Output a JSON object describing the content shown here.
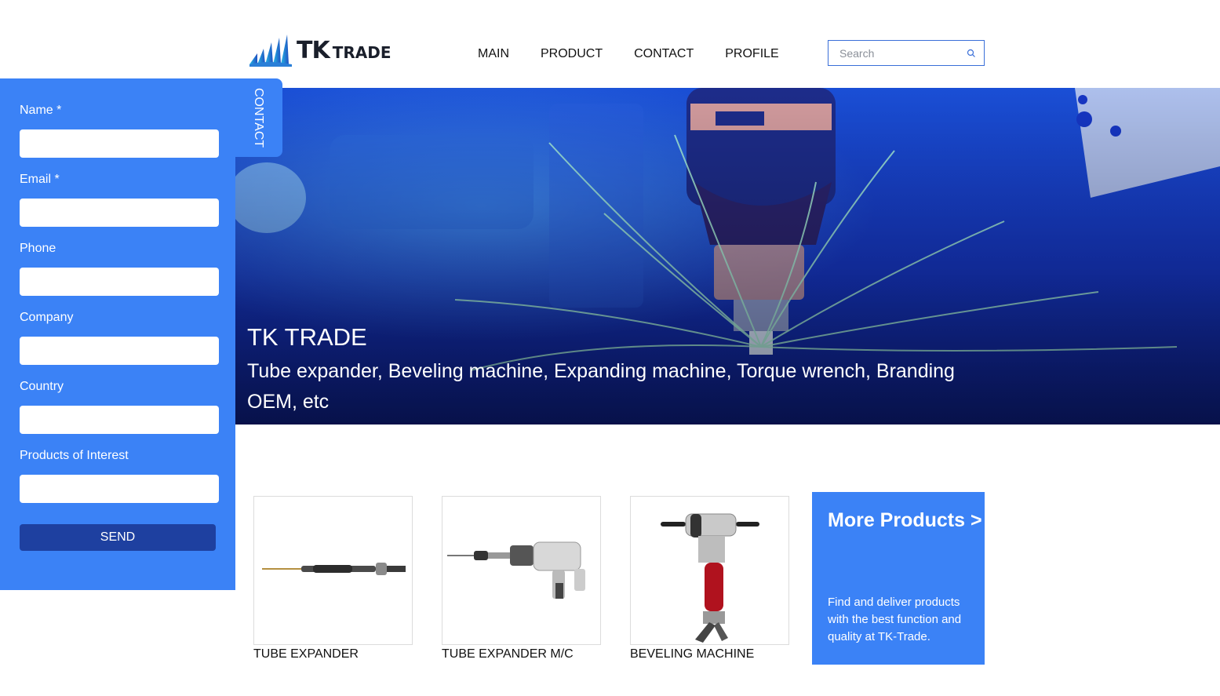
{
  "brand": {
    "logo_primary": "TK",
    "logo_secondary": "TRADE"
  },
  "nav": {
    "items": [
      "MAIN",
      "PRODUCT",
      "CONTACT",
      "PROFILE"
    ]
  },
  "search": {
    "placeholder": "Search",
    "icon": "search-icon"
  },
  "hero": {
    "title": "TK TRADE",
    "subtitle": "Tube expander, Beveling machine, Expanding machine, Torque wrench, Branding OEM, etc"
  },
  "contact_form": {
    "tab_label": "CONTACT",
    "fields": [
      {
        "label": "Name *",
        "value": ""
      },
      {
        "label": "Email *",
        "value": ""
      },
      {
        "label": "Phone",
        "value": ""
      },
      {
        "label": "Company",
        "value": ""
      },
      {
        "label": "Country",
        "value": ""
      },
      {
        "label": "Products of Interest",
        "value": ""
      }
    ],
    "submit_label": "SEND"
  },
  "products": [
    {
      "name": "TUBE EXPANDER"
    },
    {
      "name": "TUBE EXPANDER M/C"
    },
    {
      "name": "BEVELING MACHINE"
    }
  ],
  "more_products": {
    "title": "More Products >",
    "description": "Find and deliver products with the best function and quality at TK-Trade."
  },
  "colors": {
    "accent": "#3b82f6",
    "button": "#1e40a0",
    "hero_blue": "#1238c8",
    "text": "#111111"
  }
}
